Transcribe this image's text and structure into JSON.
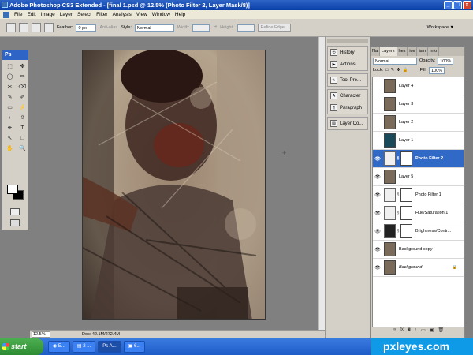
{
  "window": {
    "title": "Adobe Photoshop CS3 Extended - [final 1.psd @ 12.5% (Photo Filter 2, Layer Mask/8)]",
    "min": "_",
    "max": "□",
    "close": "x"
  },
  "menu": [
    "File",
    "Edit",
    "Image",
    "Layer",
    "Select",
    "Filter",
    "Analysis",
    "View",
    "Window",
    "Help"
  ],
  "options": {
    "feather_label": "Feather:",
    "feather_value": "0 px",
    "antialias": "Anti-alias",
    "style_label": "Style:",
    "style_value": "Normal",
    "width_label": "Width:",
    "height_label": "Height:",
    "refine_edge": "Refine Edge...",
    "workspace": "Workspace ▼"
  },
  "toolbox": {
    "logo": "Ps",
    "tools": [
      "⬚",
      "✥",
      "◯",
      "✏",
      "✂",
      "⌫",
      "✎",
      "✐",
      "▭",
      "⚡",
      "◐",
      "⇧",
      "✒",
      "T",
      "↖",
      "□",
      "✋",
      "🔍"
    ]
  },
  "status": {
    "zoom": "12.5%",
    "doc": "Doc: 42.1M/272.4M"
  },
  "dock": {
    "items": [
      "History",
      "Actions",
      "Tool Pre...",
      "Character",
      "Paragraph",
      "Layer Co..."
    ]
  },
  "layers": {
    "tabs": [
      "Na",
      "Layers",
      "hes",
      "ice",
      "ism",
      "Info"
    ],
    "blend_mode": "Normal",
    "opacity_label": "Opacity:",
    "opacity_value": "100%",
    "lock_label": "Lock:",
    "fill_label": "Fill:",
    "fill_value": "100%",
    "rows": [
      {
        "name": "Layer 4",
        "visible": false
      },
      {
        "name": "Layer 3",
        "visible": false
      },
      {
        "name": "Layer 2",
        "visible": false
      },
      {
        "name": "Layer 1",
        "visible": false
      },
      {
        "name": "Photo Filter 2",
        "visible": true,
        "selected": true
      },
      {
        "name": "Layer 5",
        "visible": true
      },
      {
        "name": "Photo Filter 1",
        "visible": true
      },
      {
        "name": "Hue/Saturation 1",
        "visible": true
      },
      {
        "name": "Brightness/Contr...",
        "visible": true
      },
      {
        "name": "Background copy",
        "visible": true
      },
      {
        "name": "Background",
        "visible": true
      }
    ]
  },
  "taskbar": {
    "start": "start",
    "tasks": [
      "E...",
      "2 ...",
      "A...",
      "6..."
    ]
  },
  "watermark": "pxleyes.com"
}
